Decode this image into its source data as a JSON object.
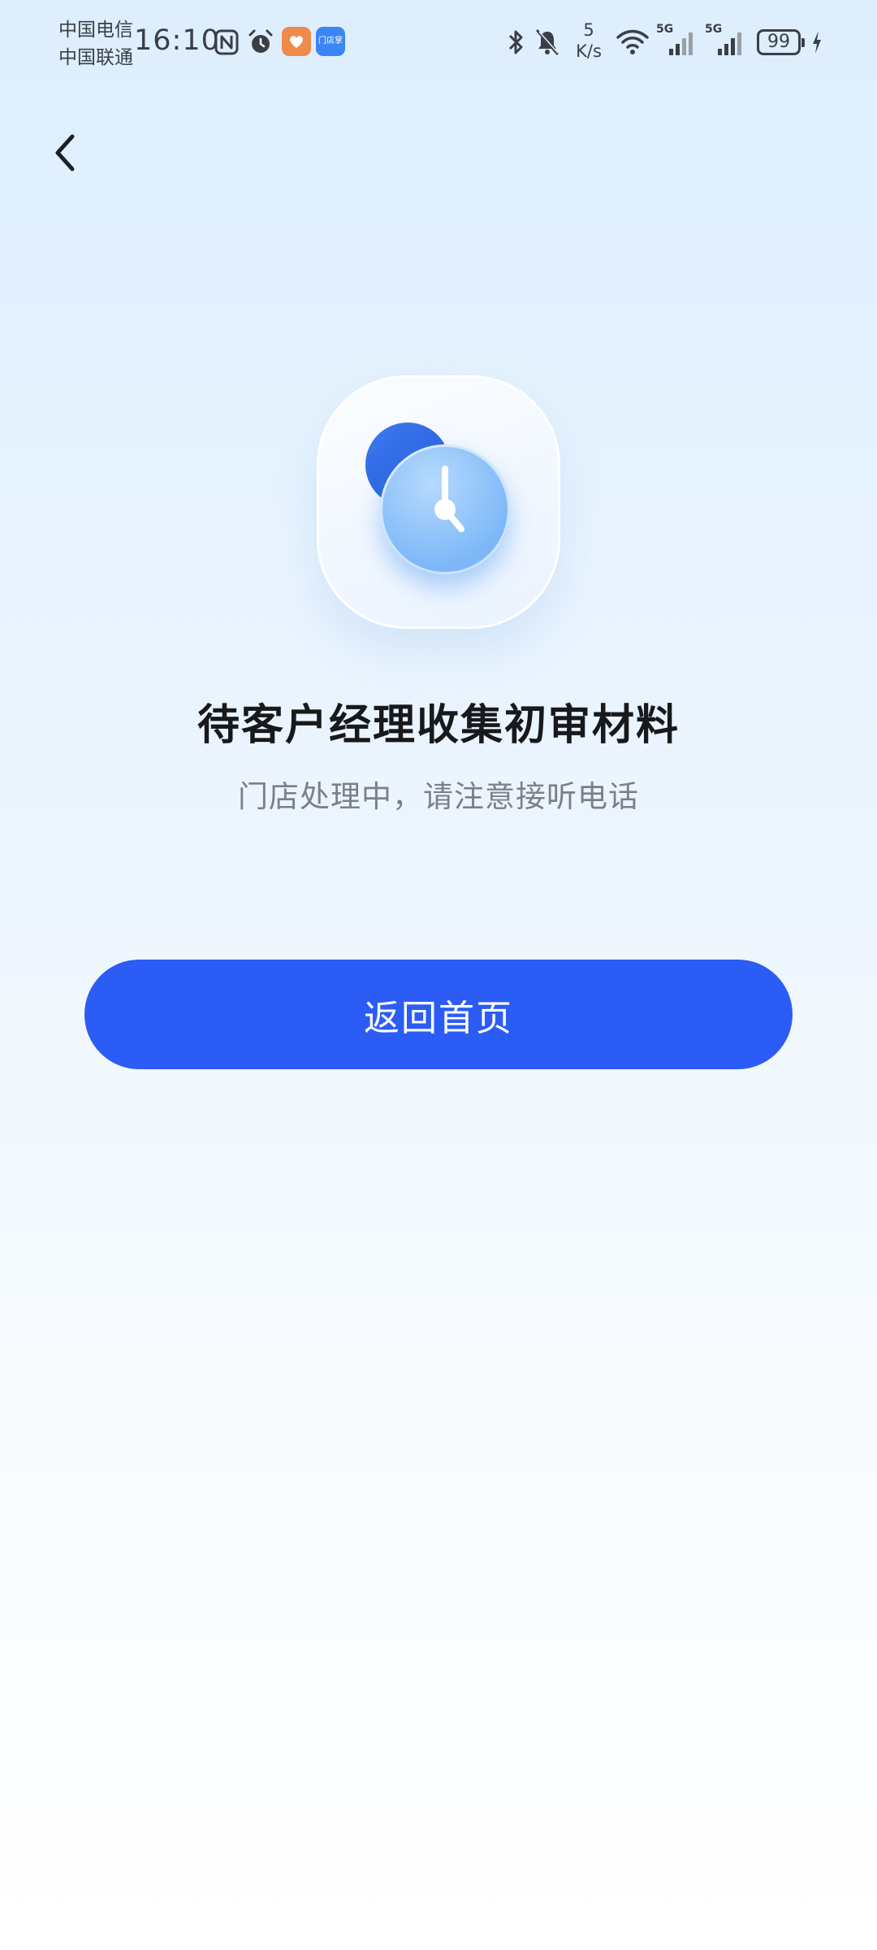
{
  "status_bar": {
    "carrier_1": "中国电信",
    "carrier_2": "中国联通",
    "time": "16:10",
    "net_speed_value": "5",
    "net_speed_unit": "K/s",
    "signal_1_label": "5G",
    "signal_2_label": "5G",
    "battery": "99",
    "app_badge_text": "门店掌"
  },
  "page": {
    "title": "待客户经理收集初审材料",
    "subtitle": "门店处理中，请注意接听电话"
  },
  "actions": {
    "home_button_label": "返回首页"
  },
  "colors": {
    "primary": "#2c5cf6",
    "title": "#17191c",
    "subtitle": "#7b8088",
    "background_top": "#ddeefd",
    "background_bottom": "#ffffff"
  },
  "icons": {
    "back": "chevron-left-icon",
    "hero": "clock-icon"
  }
}
